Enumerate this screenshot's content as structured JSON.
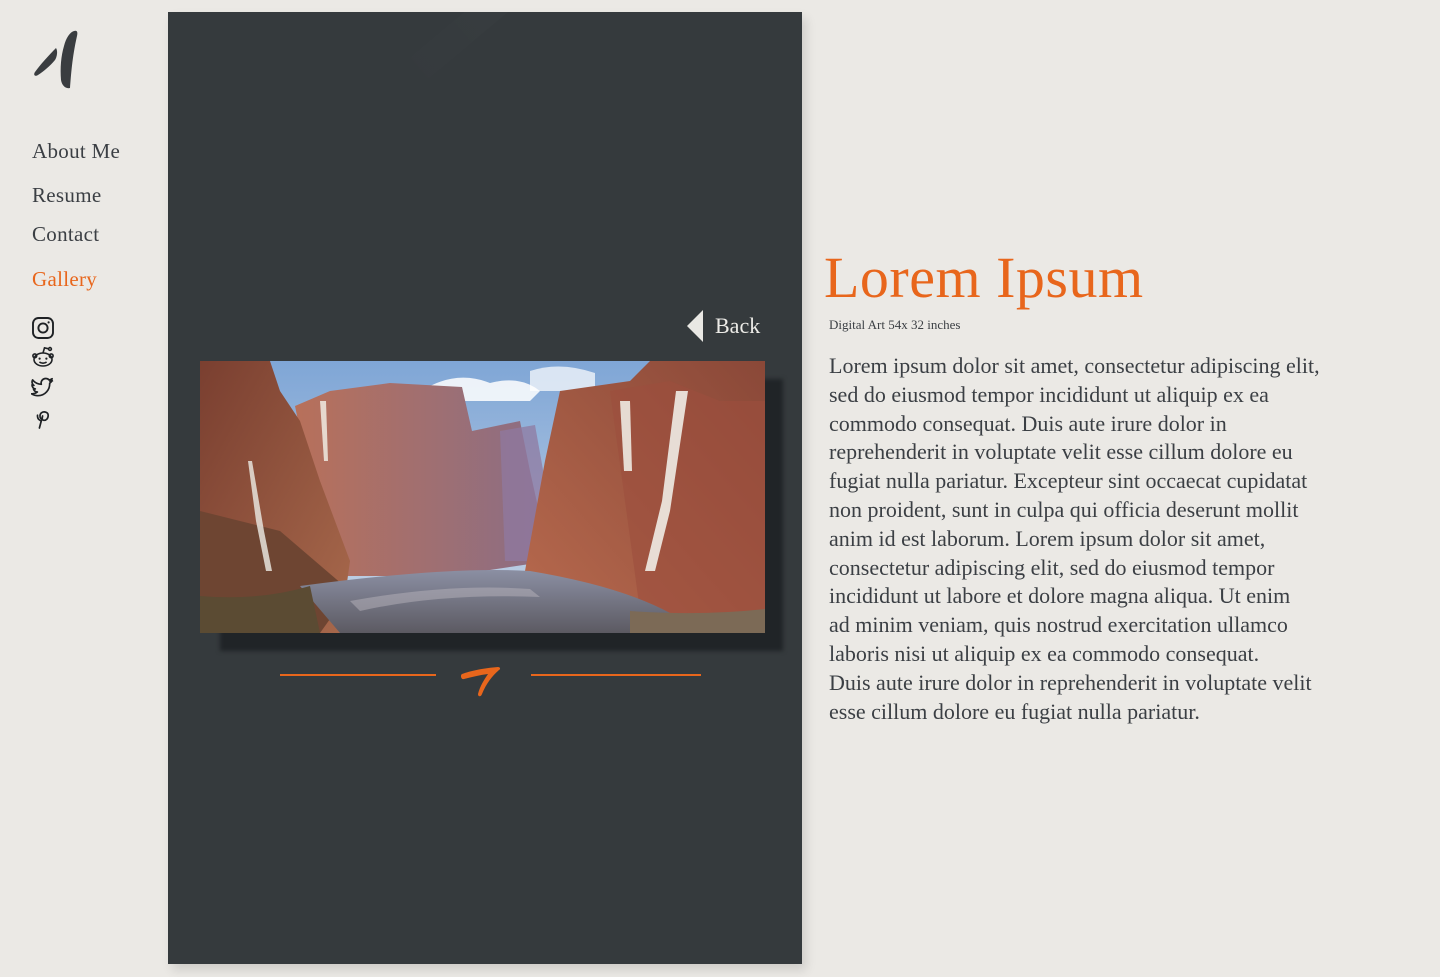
{
  "brand": {
    "logo_icon": "brush-stroke-logo-icon"
  },
  "nav": {
    "items": [
      {
        "label": "About Me",
        "active": false
      },
      {
        "label": "Resume",
        "active": false
      },
      {
        "label": "Contact",
        "active": false
      },
      {
        "label": "Gallery",
        "active": true
      }
    ]
  },
  "social": [
    {
      "name": "instagram-icon"
    },
    {
      "name": "reddit-icon"
    },
    {
      "name": "twitter-icon"
    },
    {
      "name": "pinterest-icon"
    }
  ],
  "gallery": {
    "back_label": "Back",
    "artwork_image": "canyon-waterfall-river-painting"
  },
  "artwork": {
    "title": "Lorem Ipsum",
    "meta": "Digital Art 54x 32 inches",
    "description_lines": [
      "Lorem ipsum dolor sit amet, consectetur adipiscing elit,",
      "sed do eiusmod tempor incididunt ut aliquip ex ea",
      "commodo consequat. Duis aute irure dolor in",
      "reprehenderit in voluptate velit esse cillum dolore eu",
      "fugiat nulla pariatur. Excepteur sint occaecat cupidatat",
      "non proident, sunt in culpa qui officia deserunt mollit",
      "anim id est laborum. Lorem ipsum dolor sit amet,",
      "consectetur adipiscing elit, sed do eiusmod tempor",
      "incididunt ut labore et dolore  magna aliqua.  Ut enim",
      "ad minim veniam, quis nostrud  exercitation ullamco",
      "laboris nisi ut aliquip ex ea commodo consequat.",
      "Duis aute irure dolor in  reprehenderit in voluptate velit",
      "esse cillum dolore eu fugiat nulla pariatur."
    ]
  },
  "colors": {
    "accent": "#e8661c",
    "panel": "#353a3d",
    "background": "#ebe9e5",
    "text": "#3b3f44"
  }
}
